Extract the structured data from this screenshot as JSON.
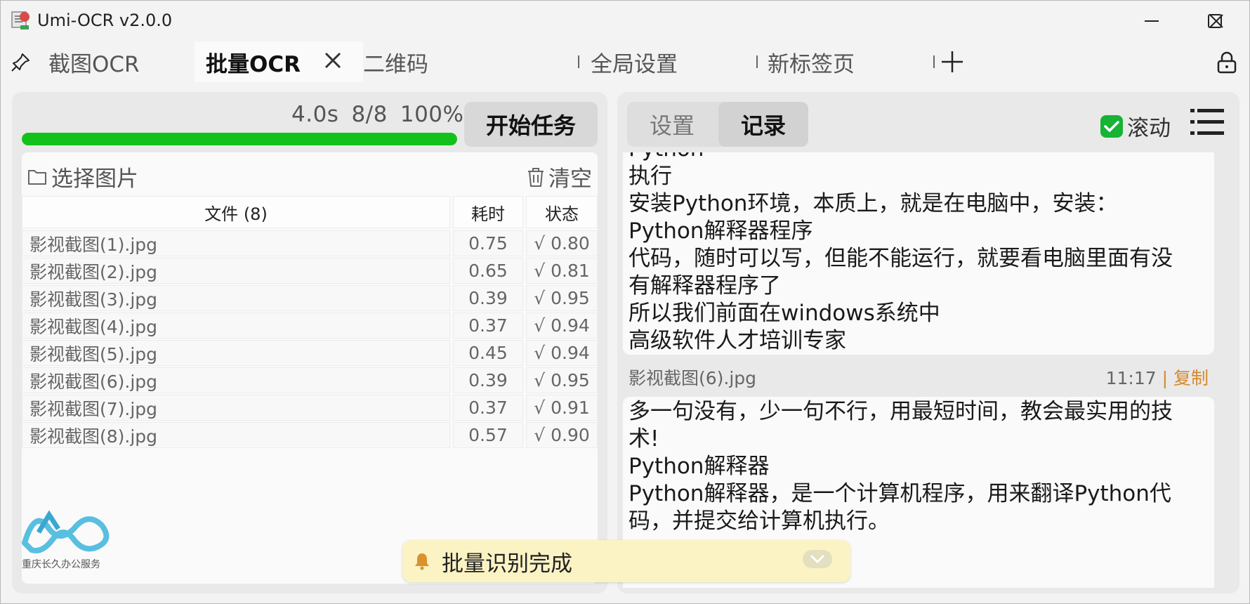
{
  "app": {
    "title": "Umi-OCR v2.0.0"
  },
  "tabs": [
    {
      "label": "截图OCR"
    },
    {
      "label": "批量OCR"
    },
    {
      "label": "二维码"
    },
    {
      "label": "全局设置"
    },
    {
      "label": "新标签页"
    }
  ],
  "batch": {
    "elapsed": "4.0s",
    "count": "8/8",
    "percent": "100%",
    "progress_fraction": 1.0,
    "start_button": "开始任务",
    "select_images": "选择图片",
    "clear": "清空",
    "columns": [
      "文件 (8)",
      "耗时",
      "状态"
    ],
    "rows": [
      {
        "file": "影视截图(1).jpg",
        "time": "0.75",
        "status": "√ 0.80"
      },
      {
        "file": "影视截图(2).jpg",
        "time": "0.65",
        "status": "√ 0.81"
      },
      {
        "file": "影视截图(3).jpg",
        "time": "0.39",
        "status": "√ 0.95"
      },
      {
        "file": "影视截图(4).jpg",
        "time": "0.37",
        "status": "√ 0.94"
      },
      {
        "file": "影视截图(5).jpg",
        "time": "0.45",
        "status": "√ 0.94"
      },
      {
        "file": "影视截图(6).jpg",
        "time": "0.39",
        "status": "√ 0.95"
      },
      {
        "file": "影视截图(7).jpg",
        "time": "0.37",
        "status": "√ 0.91"
      },
      {
        "file": "影视截图(8).jpg",
        "time": "0.57",
        "status": "√ 0.90"
      }
    ]
  },
  "logo": {
    "text": "重庆长久办公服务"
  },
  "record": {
    "tab_settings": "设置",
    "tab_record": "记录",
    "scroll_label": "滚动",
    "block1_lines": [
      "Python",
      "执行",
      "安装Python环境，本质上，就是在电脑中，安装：",
      "Python解释器程序",
      "代码，随时可以写，但能不能运行，就要看电脑里面有没",
      "有解释器程序了",
      "所以我们前面在windows系统中",
      "高级软件人才培训专家"
    ],
    "entry": {
      "file": "影视截图(6).jpg",
      "time": "11:17",
      "separator": "|",
      "copy": "复制"
    },
    "block2_lines": [
      "多一句没有，少一句不行，用最短时间，教会最实用的技",
      "术!",
      "Python解释器",
      "Python解释器，是一个计算机程序，用来翻译Python代",
      "码，并提交给计算机执行。"
    ]
  },
  "toast": {
    "message": "批量识别完成"
  },
  "colors": {
    "progress": "#12c21a",
    "check": "#16b334",
    "copy": "#d58a2c",
    "toast": "#fbf3c4"
  }
}
